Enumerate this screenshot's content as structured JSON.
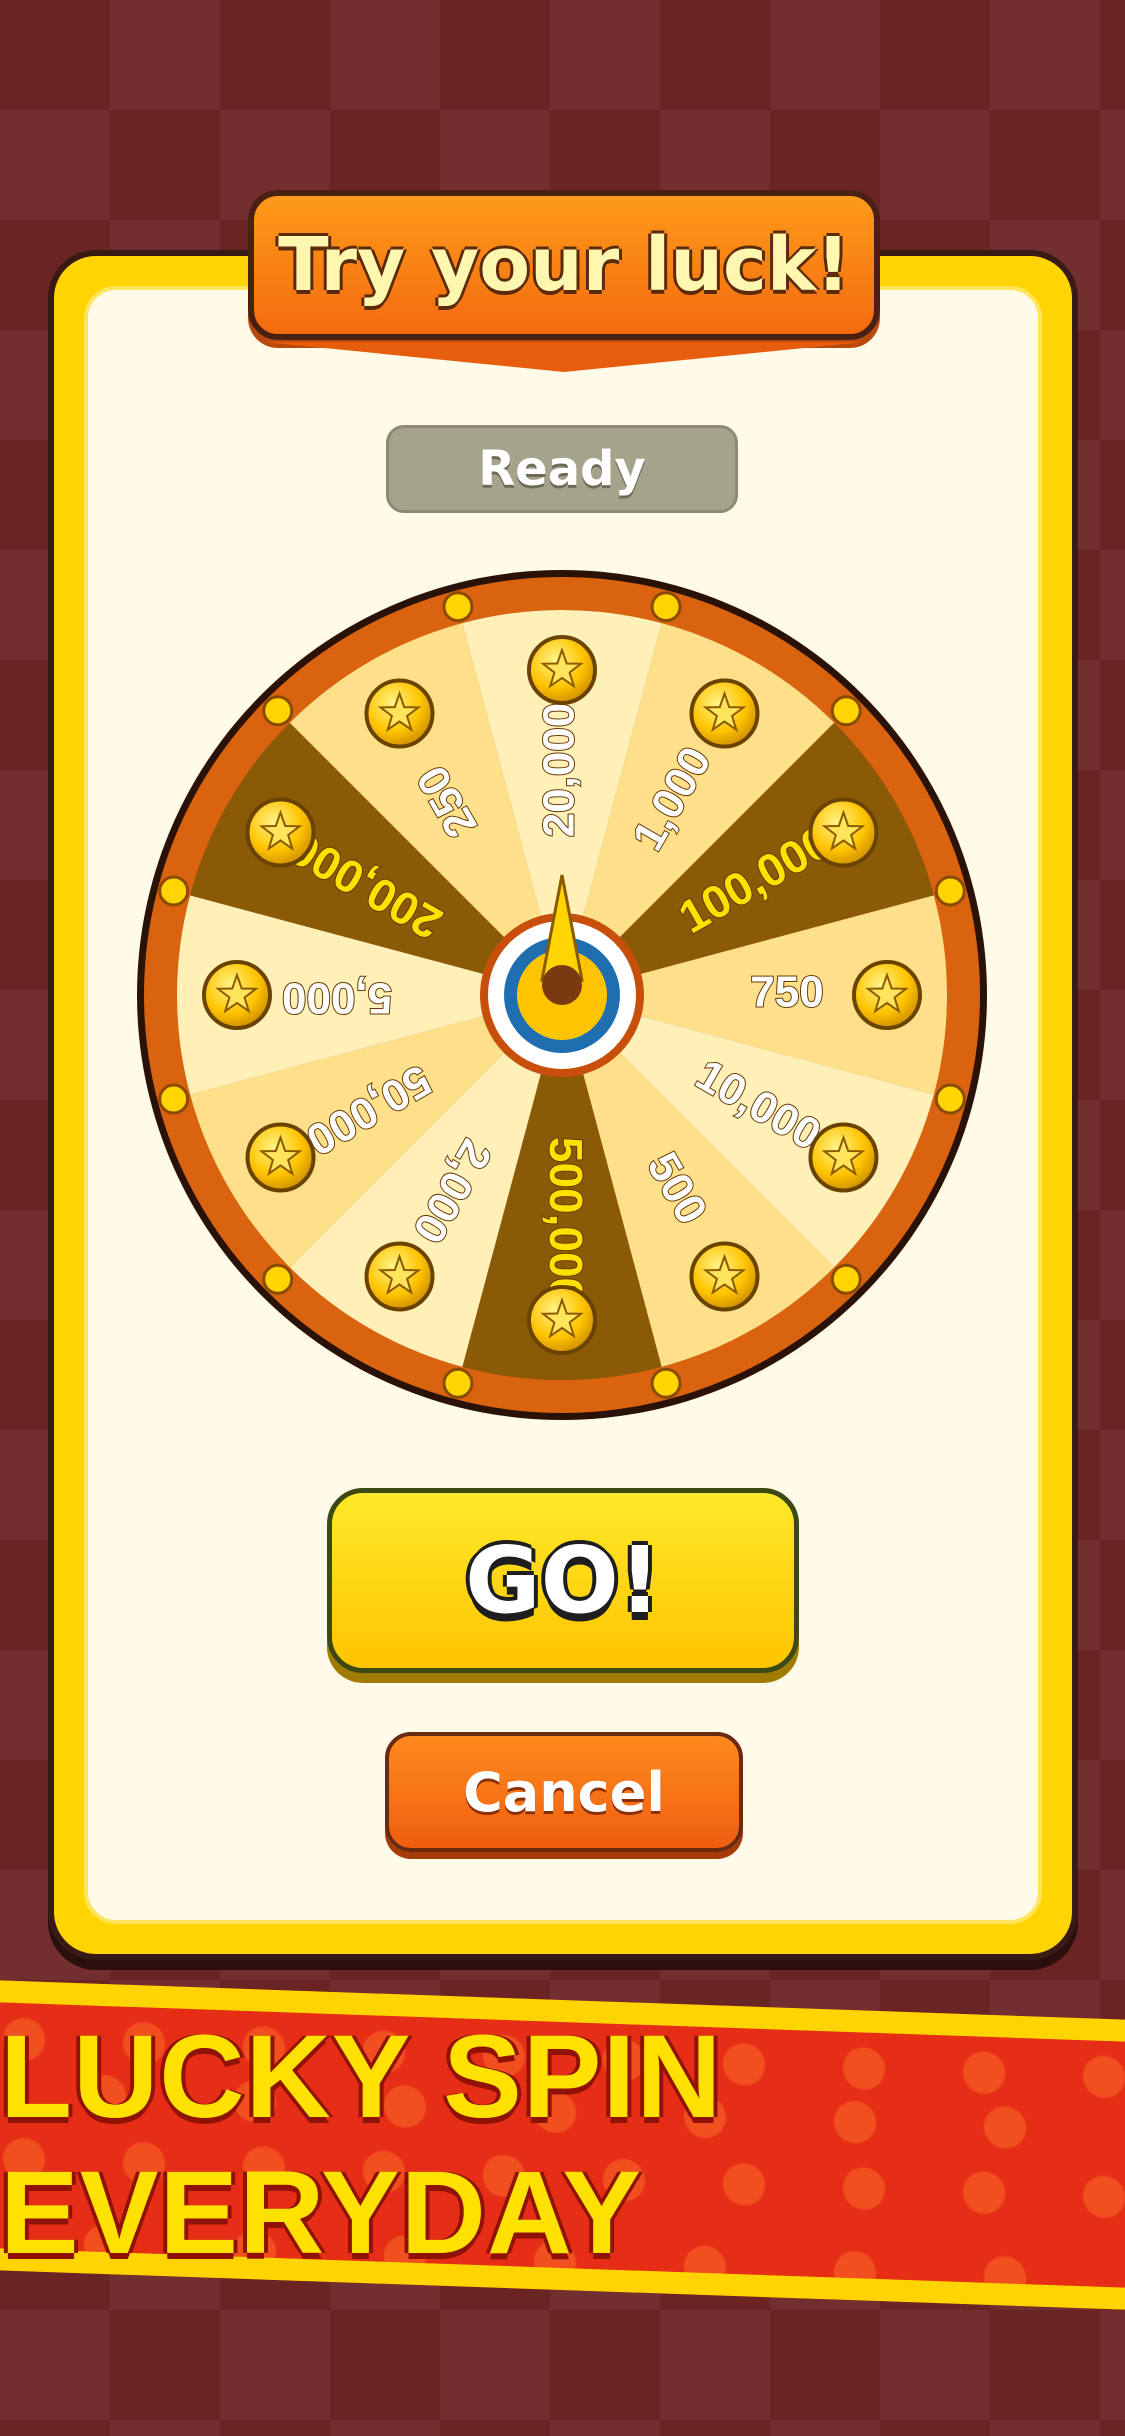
{
  "dialog": {
    "title": "Try your luck!",
    "status": "Ready",
    "go_label": "GO!",
    "cancel_label": "Cancel"
  },
  "wheel": {
    "segments": [
      "20,000",
      "1,000",
      "100,000",
      "750",
      "10,000",
      "500",
      "500,000",
      "2,000",
      "50,000",
      "5,000",
      "200,000",
      "250"
    ],
    "icon": "star-coin-icon"
  },
  "banner": {
    "text": "LUCKY SPIN EVERYDAY"
  },
  "colors": {
    "background": "#6b2424",
    "card": "#ffd400",
    "title_orange": "#f36b10",
    "go_yellow": "#ffd400",
    "wheel_rim": "#d9630f",
    "ribbon_red": "#e62e17"
  }
}
